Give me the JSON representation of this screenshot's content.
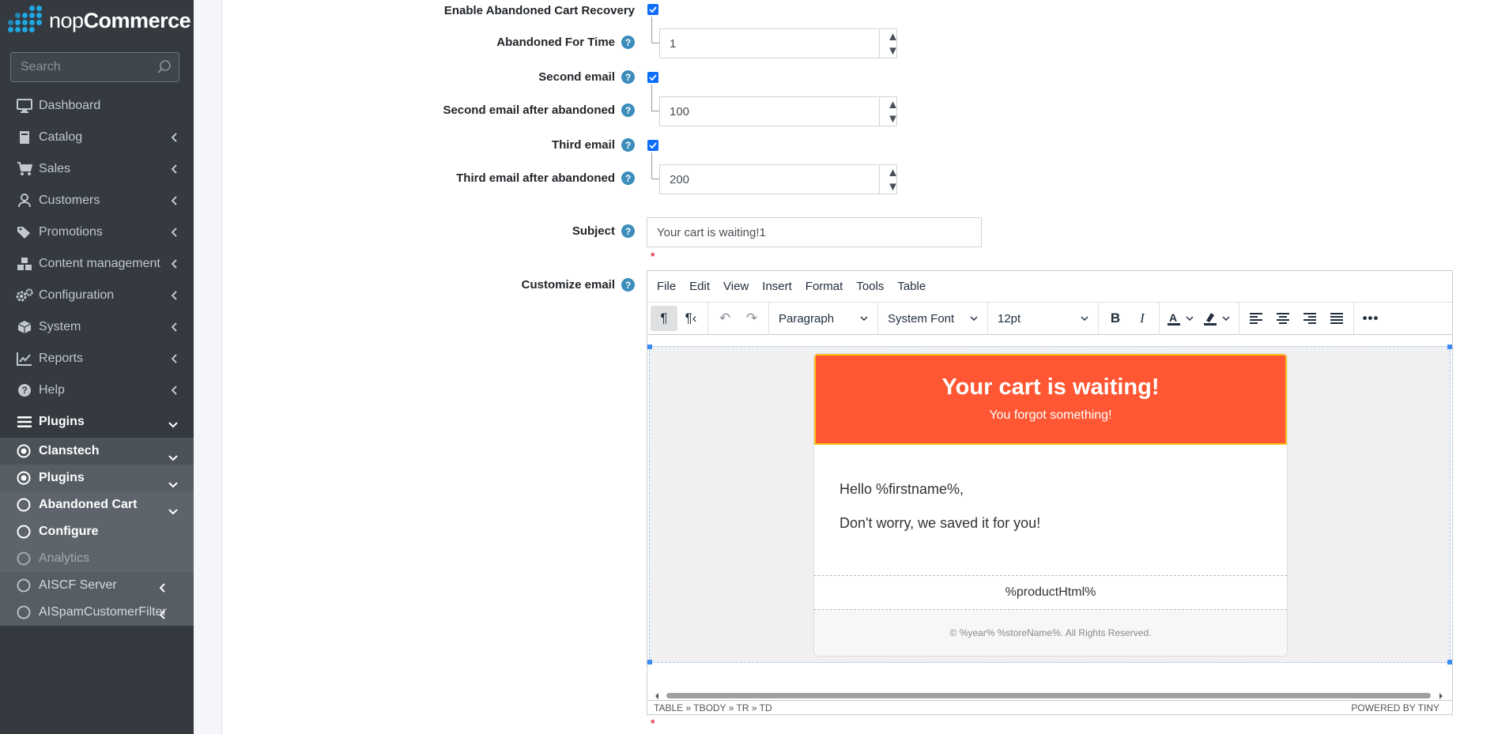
{
  "brand": {
    "name_light": "nop",
    "name_bold": "Commerce"
  },
  "search": {
    "placeholder": "Search"
  },
  "sidebar": {
    "items": [
      {
        "label": "Dashboard",
        "icon": "monitor-icon"
      },
      {
        "label": "Catalog",
        "icon": "book-icon"
      },
      {
        "label": "Sales",
        "icon": "cart-icon"
      },
      {
        "label": "Customers",
        "icon": "user-icon"
      },
      {
        "label": "Promotions",
        "icon": "tags-icon"
      },
      {
        "label": "Content management",
        "icon": "cubes-icon"
      },
      {
        "label": "Configuration",
        "icon": "gears-icon"
      },
      {
        "label": "System",
        "icon": "cube-icon"
      },
      {
        "label": "Reports",
        "icon": "chart-line-icon"
      },
      {
        "label": "Help",
        "icon": "question-circle-icon"
      },
      {
        "label": "Plugins",
        "icon": "bars-icon"
      }
    ],
    "sub_items": [
      {
        "label": "Clanstech"
      },
      {
        "label": "Plugins"
      },
      {
        "label": "Abandoned Cart"
      },
      {
        "label": "Configure"
      },
      {
        "label": "Analytics"
      },
      {
        "label": "AISCF Server"
      },
      {
        "label": "AISpamCustomerFilter"
      }
    ]
  },
  "form": {
    "enable_label": "Enable Abandoned Cart Recovery",
    "enable_checked": true,
    "abandoned_time_label": "Abandoned For Time",
    "abandoned_time_value": "1",
    "second_email_label": "Second email",
    "second_email_checked": true,
    "second_after_label": "Second email after abandoned",
    "second_after_value": "100",
    "third_email_label": "Third email",
    "third_email_checked": true,
    "third_after_label": "Third email after abandoned",
    "third_after_value": "200",
    "subject_label": "Subject",
    "subject_value": "Your cart is waiting!1",
    "customize_label": "Customize email",
    "required_mark": "*"
  },
  "editor": {
    "menus": [
      "File",
      "Edit",
      "View",
      "Insert",
      "Format",
      "Tools",
      "Table"
    ],
    "block_format": "Paragraph",
    "font_family": "System Font",
    "font_size": "12pt",
    "email": {
      "title": "Your cart is waiting!",
      "subtitle": "You forgot something!",
      "greeting": "Hello %firstname%,",
      "message": "Don't worry, we saved it for you!",
      "product_placeholder": "%productHtml%",
      "footer": "© %year% %storeName%. All Rights Reserved."
    },
    "path": "TABLE » TBODY » TR » TD",
    "powered_by": "POWERED BY TINY"
  },
  "colors": {
    "accent": "#3c8dbc",
    "sidebar_bg": "#343a40",
    "email_header": "#ff5733",
    "checkbox": "#0d6efd"
  }
}
